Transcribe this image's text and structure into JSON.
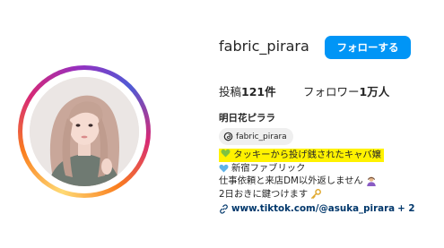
{
  "profile": {
    "username": "fabric_pirara",
    "follow_label": "フォローする",
    "posts": {
      "label": "投稿",
      "count": "121件"
    },
    "followers": {
      "label": "フォロワー",
      "count": "1万人"
    },
    "display_name": "明日花ピララ",
    "threads_handle": "fabric_pirara",
    "bio": {
      "line1": "タッキーから投げ銭されたキャバ嬢",
      "line2": "新宿ファブリック",
      "line3": "仕事依頼と来店DM以外返しません",
      "line4": "2日おきに鍵つけます",
      "link_text": "www.tiktok.com/@asuka_pirara",
      "link_more": "+ 2"
    }
  },
  "colors": {
    "follow_button": "#0095f6",
    "highlight": "#fff200",
    "link": "#00376b",
    "green_heart": "#7fc241",
    "blue_heart": "#5fb3e8"
  },
  "icons": [
    "green-heart-icon",
    "blue-heart-icon",
    "person-icon",
    "key-icon",
    "threads-icon",
    "link-icon"
  ]
}
